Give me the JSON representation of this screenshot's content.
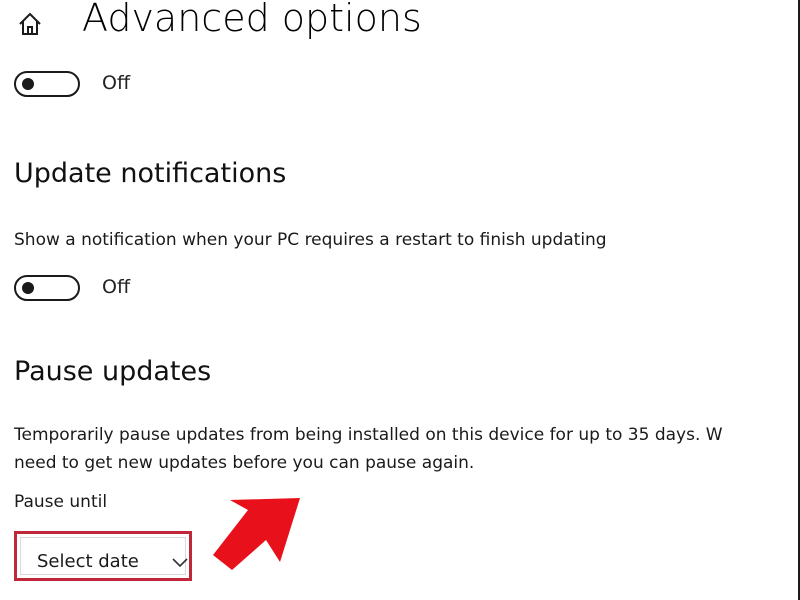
{
  "header": {
    "home_icon": "home-icon",
    "title": "Advanced options"
  },
  "top_toggle": {
    "state": "Off",
    "on": false
  },
  "update_notifications": {
    "heading": "Update notifications",
    "description": "Show a notification when your PC requires a restart to finish updating",
    "toggle_state": "Off",
    "on": false
  },
  "pause_updates": {
    "heading": "Pause updates",
    "description_line1": "Temporarily pause updates from being installed on this device for up to 35 days. W",
    "description_line2": "need to get new updates before you can pause again.",
    "pause_until_label": "Pause until",
    "select": {
      "value": "Select date",
      "icon": "chevron-down-icon"
    }
  },
  "annotation": {
    "arrow_color": "#e8101a",
    "highlight_color": "#c0283a"
  }
}
